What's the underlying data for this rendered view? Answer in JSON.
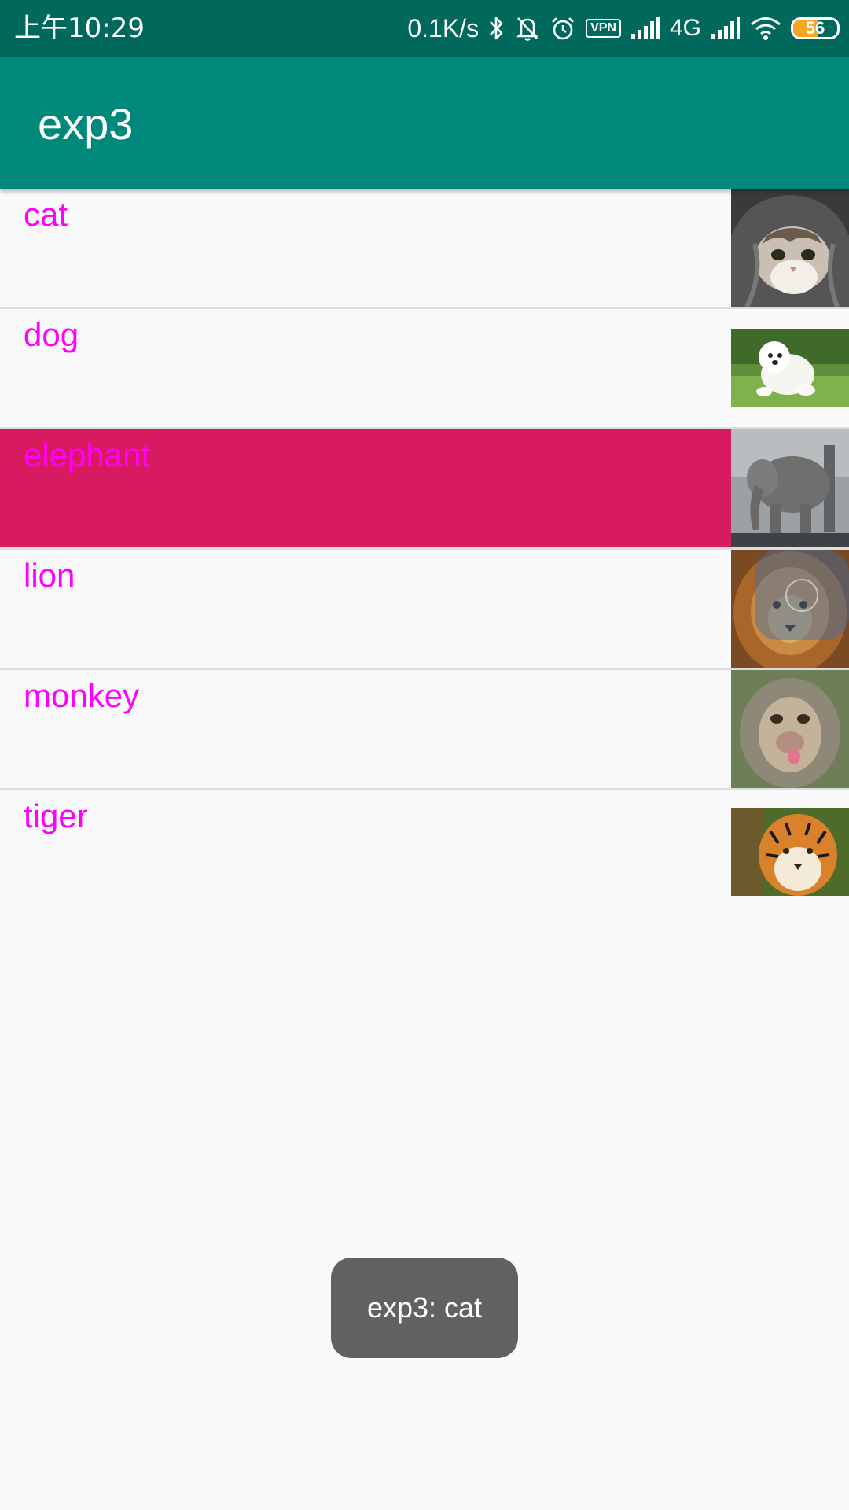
{
  "status_bar": {
    "time": "上午10:29",
    "speed": "0.1K/s",
    "vpn": "VPN",
    "network": "4G",
    "battery_level": 56,
    "battery_text": "56",
    "icons": [
      "bluetooth-icon",
      "mute-bell-icon",
      "alarm-icon",
      "vpn-icon",
      "signal-icon",
      "signal-icon",
      "wifi-icon",
      "battery-icon"
    ]
  },
  "app_bar": {
    "title": "exp3"
  },
  "list": {
    "items": [
      {
        "label": "cat",
        "image": "cat-photo",
        "selected": false
      },
      {
        "label": "dog",
        "image": "dog-photo",
        "selected": false
      },
      {
        "label": "elephant",
        "image": "elephant-photo",
        "selected": true
      },
      {
        "label": "lion",
        "image": "lion-photo",
        "selected": false
      },
      {
        "label": "monkey",
        "image": "monkey-photo",
        "selected": false
      },
      {
        "label": "tiger",
        "image": "tiger-photo",
        "selected": false
      }
    ]
  },
  "colors": {
    "status_bar": "#00695c",
    "app_bar": "#00897b",
    "item_text": "#ff00ff",
    "selected_row": "#d81b60",
    "toast_bg": "#616161"
  },
  "toast": {
    "text": "exp3: cat"
  }
}
